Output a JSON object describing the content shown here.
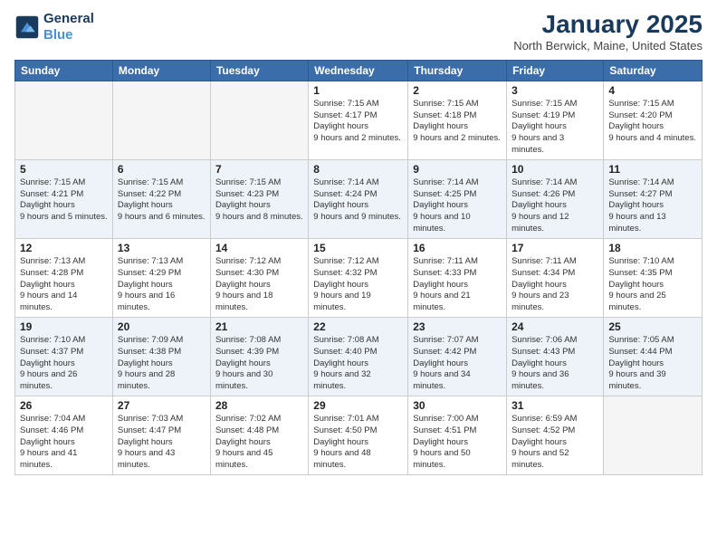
{
  "header": {
    "logo_line1": "General",
    "logo_line2": "Blue",
    "month": "January 2025",
    "location": "North Berwick, Maine, United States"
  },
  "weekdays": [
    "Sunday",
    "Monday",
    "Tuesday",
    "Wednesday",
    "Thursday",
    "Friday",
    "Saturday"
  ],
  "weeks": [
    [
      {
        "day": "",
        "empty": true
      },
      {
        "day": "",
        "empty": true
      },
      {
        "day": "",
        "empty": true
      },
      {
        "day": "1",
        "sunrise": "7:15 AM",
        "sunset": "4:17 PM",
        "daylight": "9 hours and 2 minutes."
      },
      {
        "day": "2",
        "sunrise": "7:15 AM",
        "sunset": "4:18 PM",
        "daylight": "9 hours and 2 minutes."
      },
      {
        "day": "3",
        "sunrise": "7:15 AM",
        "sunset": "4:19 PM",
        "daylight": "9 hours and 3 minutes."
      },
      {
        "day": "4",
        "sunrise": "7:15 AM",
        "sunset": "4:20 PM",
        "daylight": "9 hours and 4 minutes."
      }
    ],
    [
      {
        "day": "5",
        "sunrise": "7:15 AM",
        "sunset": "4:21 PM",
        "daylight": "9 hours and 5 minutes."
      },
      {
        "day": "6",
        "sunrise": "7:15 AM",
        "sunset": "4:22 PM",
        "daylight": "9 hours and 6 minutes."
      },
      {
        "day": "7",
        "sunrise": "7:15 AM",
        "sunset": "4:23 PM",
        "daylight": "9 hours and 8 minutes."
      },
      {
        "day": "8",
        "sunrise": "7:14 AM",
        "sunset": "4:24 PM",
        "daylight": "9 hours and 9 minutes."
      },
      {
        "day": "9",
        "sunrise": "7:14 AM",
        "sunset": "4:25 PM",
        "daylight": "9 hours and 10 minutes."
      },
      {
        "day": "10",
        "sunrise": "7:14 AM",
        "sunset": "4:26 PM",
        "daylight": "9 hours and 12 minutes."
      },
      {
        "day": "11",
        "sunrise": "7:14 AM",
        "sunset": "4:27 PM",
        "daylight": "9 hours and 13 minutes."
      }
    ],
    [
      {
        "day": "12",
        "sunrise": "7:13 AM",
        "sunset": "4:28 PM",
        "daylight": "9 hours and 14 minutes."
      },
      {
        "day": "13",
        "sunrise": "7:13 AM",
        "sunset": "4:29 PM",
        "daylight": "9 hours and 16 minutes."
      },
      {
        "day": "14",
        "sunrise": "7:12 AM",
        "sunset": "4:30 PM",
        "daylight": "9 hours and 18 minutes."
      },
      {
        "day": "15",
        "sunrise": "7:12 AM",
        "sunset": "4:32 PM",
        "daylight": "9 hours and 19 minutes."
      },
      {
        "day": "16",
        "sunrise": "7:11 AM",
        "sunset": "4:33 PM",
        "daylight": "9 hours and 21 minutes."
      },
      {
        "day": "17",
        "sunrise": "7:11 AM",
        "sunset": "4:34 PM",
        "daylight": "9 hours and 23 minutes."
      },
      {
        "day": "18",
        "sunrise": "7:10 AM",
        "sunset": "4:35 PM",
        "daylight": "9 hours and 25 minutes."
      }
    ],
    [
      {
        "day": "19",
        "sunrise": "7:10 AM",
        "sunset": "4:37 PM",
        "daylight": "9 hours and 26 minutes."
      },
      {
        "day": "20",
        "sunrise": "7:09 AM",
        "sunset": "4:38 PM",
        "daylight": "9 hours and 28 minutes."
      },
      {
        "day": "21",
        "sunrise": "7:08 AM",
        "sunset": "4:39 PM",
        "daylight": "9 hours and 30 minutes."
      },
      {
        "day": "22",
        "sunrise": "7:08 AM",
        "sunset": "4:40 PM",
        "daylight": "9 hours and 32 minutes."
      },
      {
        "day": "23",
        "sunrise": "7:07 AM",
        "sunset": "4:42 PM",
        "daylight": "9 hours and 34 minutes."
      },
      {
        "day": "24",
        "sunrise": "7:06 AM",
        "sunset": "4:43 PM",
        "daylight": "9 hours and 36 minutes."
      },
      {
        "day": "25",
        "sunrise": "7:05 AM",
        "sunset": "4:44 PM",
        "daylight": "9 hours and 39 minutes."
      }
    ],
    [
      {
        "day": "26",
        "sunrise": "7:04 AM",
        "sunset": "4:46 PM",
        "daylight": "9 hours and 41 minutes."
      },
      {
        "day": "27",
        "sunrise": "7:03 AM",
        "sunset": "4:47 PM",
        "daylight": "9 hours and 43 minutes."
      },
      {
        "day": "28",
        "sunrise": "7:02 AM",
        "sunset": "4:48 PM",
        "daylight": "9 hours and 45 minutes."
      },
      {
        "day": "29",
        "sunrise": "7:01 AM",
        "sunset": "4:50 PM",
        "daylight": "9 hours and 48 minutes."
      },
      {
        "day": "30",
        "sunrise": "7:00 AM",
        "sunset": "4:51 PM",
        "daylight": "9 hours and 50 minutes."
      },
      {
        "day": "31",
        "sunrise": "6:59 AM",
        "sunset": "4:52 PM",
        "daylight": "9 hours and 52 minutes."
      },
      {
        "day": "",
        "empty": true
      }
    ]
  ]
}
